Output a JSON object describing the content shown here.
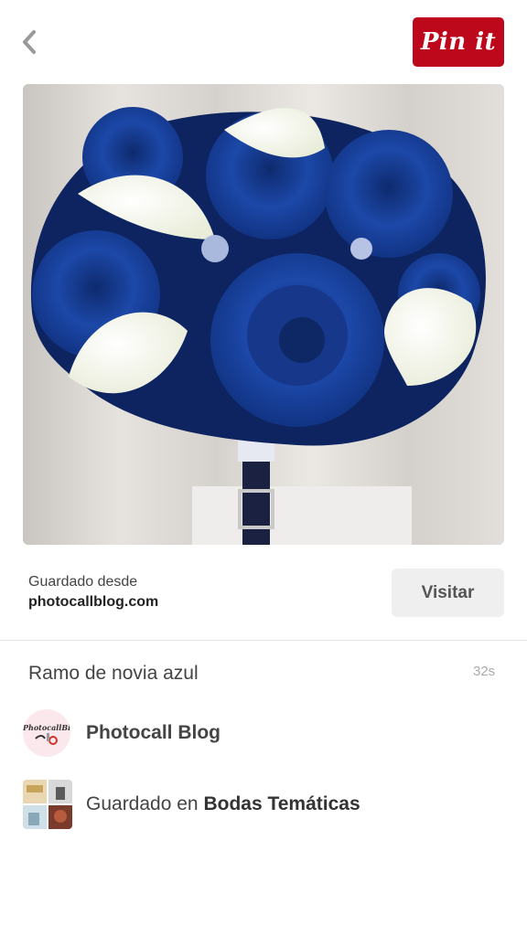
{
  "header": {
    "back_icon": "chevron-left-icon",
    "pin_button_label": "Pin it",
    "pin_button_color": "#bd081c"
  },
  "pin": {
    "image_alt": "Blue rose and white calla lily bridal bouquet",
    "saved_from_label": "Guardado desde",
    "source_domain": "photocallblog.com",
    "visit_label": "Visitar",
    "title": "Ramo de novia azul",
    "timestamp": "32s"
  },
  "author": {
    "name": "Photocall Blog",
    "avatar_text": "PhotocallBlog"
  },
  "board": {
    "saved_in_label": "Guardado en",
    "name": "Bodas Temáticas"
  },
  "colors": {
    "accent_red": "#bd081c",
    "visit_bg": "#efefef",
    "rose_blue": "#1a3f9a"
  }
}
